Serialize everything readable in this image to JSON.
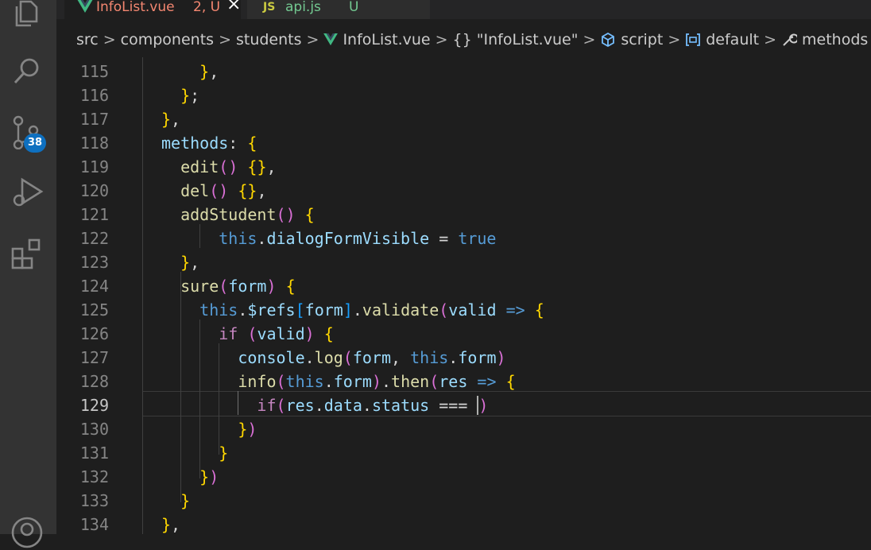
{
  "tabs": [
    {
      "icon": "vue-icon",
      "name": "InfoList.vue",
      "status": "2, U",
      "close": "×",
      "color": "#f48771"
    },
    {
      "icon": "js-icon",
      "icon_text": "JS",
      "name": "api.js",
      "status": "U",
      "color": "#73c991"
    }
  ],
  "breadcrumb": {
    "items": [
      "src",
      "components",
      "students",
      "InfoList.vue",
      "{} \"InfoList.vue\"",
      "script",
      "default",
      "methods"
    ],
    "separator": ">"
  },
  "activity_bar": {
    "icons": [
      "files-icon",
      "search-icon",
      "source-control-icon",
      "run-debug-icon",
      "extensions-icon",
      "account-icon"
    ],
    "source_control_badge": "38"
  },
  "editor": {
    "current_line": "129",
    "lines": [
      {
        "no": "115",
        "code": "    },"
      },
      {
        "no": "116",
        "code": "  };"
      },
      {
        "no": "117",
        "code": "},"
      },
      {
        "no": "118",
        "code": "methods: {"
      },
      {
        "no": "119",
        "code": "  edit() {},"
      },
      {
        "no": "120",
        "code": "  del() {},"
      },
      {
        "no": "121",
        "code": "  addStudent() {"
      },
      {
        "no": "122",
        "code": "      this.dialogFormVisible = true"
      },
      {
        "no": "123",
        "code": "  },"
      },
      {
        "no": "124",
        "code": "  sure(form) {"
      },
      {
        "no": "125",
        "code": "    this.$refs[form].validate(valid => {"
      },
      {
        "no": "126",
        "code": "      if (valid) {"
      },
      {
        "no": "127",
        "code": "        console.log(form, this.form)"
      },
      {
        "no": "128",
        "code": "        info(this.form).then(res => {"
      },
      {
        "no": "129",
        "code": "          if(res.data.status === )"
      },
      {
        "no": "130",
        "code": "        })"
      },
      {
        "no": "131",
        "code": "      }"
      },
      {
        "no": "132",
        "code": "    })"
      },
      {
        "no": "133",
        "code": "  }"
      },
      {
        "no": "134",
        "code": "},"
      }
    ]
  },
  "colors": {
    "editor_bg": "#1e1e1e",
    "activity_bg": "#333333",
    "badge": "#0e70c0",
    "modified_tab": "#f48771",
    "untracked_tab": "#73c991"
  }
}
